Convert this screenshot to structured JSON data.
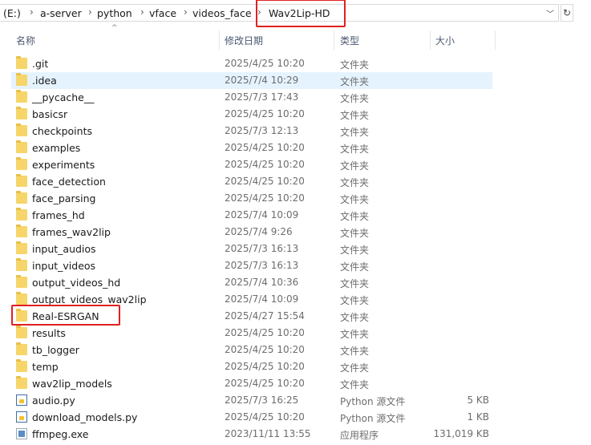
{
  "address_bar": {
    "crumbs": [
      "(E:)",
      "a-server",
      "python",
      "vface",
      "videos_face",
      "Wav2Lip-HD"
    ],
    "dropdown_icon": "chevron-down-icon",
    "refresh_icon": "refresh-icon"
  },
  "columns": {
    "name": "名称",
    "date": "修改日期",
    "type": "类型",
    "size": "大小",
    "sort_indicator": "^"
  },
  "colors": {
    "highlight_red": "#e02020",
    "selection_blue": "#e5f3ff",
    "folder_yellow": "#f6d56a"
  },
  "files": [
    {
      "name": ".git",
      "date": "2025/4/25 10:20",
      "type": "文件夹",
      "size": "",
      "kind": "folder"
    },
    {
      "name": ".idea",
      "date": "2025/7/4 10:29",
      "type": "文件夹",
      "size": "",
      "kind": "folder",
      "selected": true
    },
    {
      "name": "__pycache__",
      "date": "2025/7/3 17:43",
      "type": "文件夹",
      "size": "",
      "kind": "folder"
    },
    {
      "name": "basicsr",
      "date": "2025/4/25 10:20",
      "type": "文件夹",
      "size": "",
      "kind": "folder"
    },
    {
      "name": "checkpoints",
      "date": "2025/7/3 12:13",
      "type": "文件夹",
      "size": "",
      "kind": "folder"
    },
    {
      "name": "examples",
      "date": "2025/4/25 10:20",
      "type": "文件夹",
      "size": "",
      "kind": "folder"
    },
    {
      "name": "experiments",
      "date": "2025/4/25 10:20",
      "type": "文件夹",
      "size": "",
      "kind": "folder"
    },
    {
      "name": "face_detection",
      "date": "2025/4/25 10:20",
      "type": "文件夹",
      "size": "",
      "kind": "folder"
    },
    {
      "name": "face_parsing",
      "date": "2025/4/25 10:20",
      "type": "文件夹",
      "size": "",
      "kind": "folder"
    },
    {
      "name": "frames_hd",
      "date": "2025/7/4 10:09",
      "type": "文件夹",
      "size": "",
      "kind": "folder"
    },
    {
      "name": "frames_wav2lip",
      "date": "2025/7/4 9:26",
      "type": "文件夹",
      "size": "",
      "kind": "folder"
    },
    {
      "name": "input_audios",
      "date": "2025/7/3 16:13",
      "type": "文件夹",
      "size": "",
      "kind": "folder"
    },
    {
      "name": "input_videos",
      "date": "2025/7/3 16:13",
      "type": "文件夹",
      "size": "",
      "kind": "folder"
    },
    {
      "name": "output_videos_hd",
      "date": "2025/7/4 10:36",
      "type": "文件夹",
      "size": "",
      "kind": "folder"
    },
    {
      "name": "output_videos_wav2lip",
      "date": "2025/7/4 10:09",
      "type": "文件夹",
      "size": "",
      "kind": "folder"
    },
    {
      "name": "Real-ESRGAN",
      "date": "2025/4/27 15:54",
      "type": "文件夹",
      "size": "",
      "kind": "folder",
      "highlighted": true
    },
    {
      "name": "results",
      "date": "2025/4/25 10:20",
      "type": "文件夹",
      "size": "",
      "kind": "folder"
    },
    {
      "name": "tb_logger",
      "date": "2025/4/25 10:20",
      "type": "文件夹",
      "size": "",
      "kind": "folder"
    },
    {
      "name": "temp",
      "date": "2025/4/25 10:20",
      "type": "文件夹",
      "size": "",
      "kind": "folder"
    },
    {
      "name": "wav2lip_models",
      "date": "2025/4/25 10:20",
      "type": "文件夹",
      "size": "",
      "kind": "folder"
    },
    {
      "name": "audio.py",
      "date": "2025/7/3 16:25",
      "type": "Python 源文件",
      "size": "5 KB",
      "kind": "py"
    },
    {
      "name": "download_models.py",
      "date": "2025/4/25 10:20",
      "type": "Python 源文件",
      "size": "1 KB",
      "kind": "py"
    },
    {
      "name": "ffmpeg.exe",
      "date": "2023/11/11 13:55",
      "type": "应用程序",
      "size": "131,019 KB",
      "kind": "exe"
    }
  ]
}
